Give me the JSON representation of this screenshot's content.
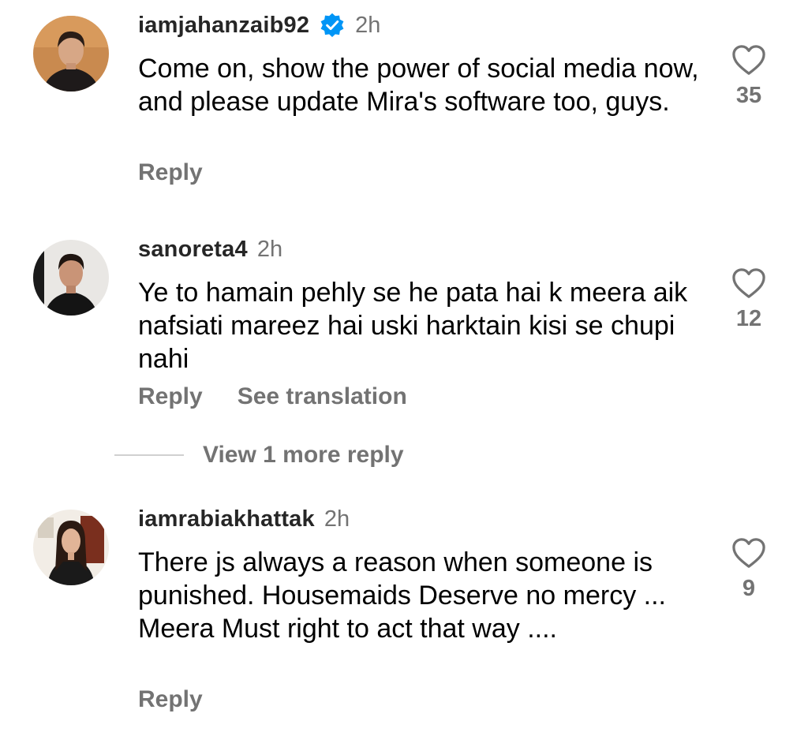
{
  "comments": [
    {
      "username": "iamjahanzaib92",
      "verified": true,
      "time": "2h",
      "text": "Come on, show the power of social media now, and please update Mira's software too, guys.",
      "reply_label": "Reply",
      "like_count": "35",
      "icons": {
        "verified": "verified-badge-icon",
        "like": "heart-icon"
      }
    },
    {
      "username": "sanoreta4",
      "verified": false,
      "time": "2h",
      "text": "Ye to hamain pehly se he pata hai k meera aik nafsiati mareez hai uski harktain kisi se chupi nahi",
      "reply_label": "Reply",
      "translate_label": "See translation",
      "like_count": "12",
      "icons": {
        "like": "heart-icon"
      }
    },
    {
      "username": "iamrabiakhattak",
      "verified": false,
      "time": "2h",
      "text": "There js  always a reason when someone is punished.  Housemaids  Deserve no mercy ... Meera Must right to act that way ....",
      "reply_label": "Reply",
      "like_count": "9",
      "icons": {
        "like": "heart-icon"
      }
    }
  ],
  "view_more_replies": "View 1 more reply",
  "colors": {
    "primary_text": "#000000",
    "username": "#262626",
    "secondary_text": "#737373",
    "verified_blue": "#0095F6",
    "divider": "#d0d0d0"
  }
}
